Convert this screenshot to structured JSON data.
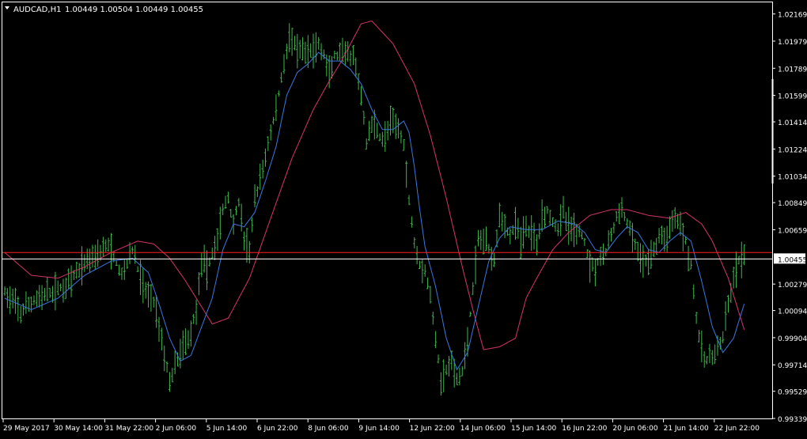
{
  "header": {
    "symbol": "AUDCAD,H1",
    "ohlc": "1.00449 1.00504 1.00449 1.00455"
  },
  "colors": {
    "background": "#000000",
    "frame": "#ffffff",
    "bars": "#3cb84a",
    "ma_fast": "#3a78e0",
    "bollinger": "#d8326c",
    "price_line": "#ffffff",
    "red_line": "#ff2020",
    "price_marker_bg": "#ffffff",
    "text": "#ffffff"
  },
  "chart_data": {
    "type": "ohlc",
    "xlabel": "",
    "ylabel": "",
    "ylim": [
      0.99339,
      1.0225
    ],
    "grid": false,
    "y_ticks": [
      "1.02169",
      "1.01979",
      "1.01789",
      "1.01599",
      "1.01414",
      "1.01224",
      "1.01034",
      "1.00849",
      "1.00659",
      "1.00455",
      "1.00279",
      "1.00094",
      "0.99904",
      "0.99714",
      "0.99529",
      "0.99339"
    ],
    "x_ticks": [
      "29 May 2017",
      "30 May 14:00",
      "31 May 22:00",
      "2 Jun 06:00",
      "5 Jun 14:00",
      "6 Jun 22:00",
      "8 Jun 06:00",
      "9 Jun 14:00",
      "12 Jun 22:00",
      "14 Jun 06:00",
      "15 Jun 14:00",
      "16 Jun 22:00",
      "20 Jun 06:00",
      "21 Jun 14:00",
      "22 Jun 22:00"
    ],
    "current_price": 1.00455,
    "horizontal_lines": [
      {
        "name": "red-level",
        "value": 1.005
      }
    ],
    "price_path": [
      [
        0,
        1.0022
      ],
      [
        6,
        1.0008
      ],
      [
        12,
        1.0018
      ],
      [
        18,
        1.0022
      ],
      [
        24,
        1.0028
      ],
      [
        30,
        1.0043
      ],
      [
        34,
        1.0049
      ],
      [
        39,
        1.0055
      ],
      [
        44,
        1.0034
      ],
      [
        48,
        1.0052
      ],
      [
        52,
        1.0026
      ],
      [
        56,
        1.0016
      ],
      [
        58,
        1.0
      ],
      [
        60,
        0.9978
      ],
      [
        62,
        0.996
      ],
      [
        64,
        0.997
      ],
      [
        66,
        0.998
      ],
      [
        70,
        0.9994
      ],
      [
        72,
        1.0012
      ],
      [
        74,
        1.0044
      ],
      [
        76,
        1.0038
      ],
      [
        80,
        1.006
      ],
      [
        82,
        1.008
      ],
      [
        84,
        1.0088
      ],
      [
        86,
        1.007
      ],
      [
        88,
        1.0086
      ],
      [
        90,
        1.0058
      ],
      [
        92,
        1.0052
      ],
      [
        94,
        1.0086
      ],
      [
        96,
        1.01
      ],
      [
        98,
        1.0118
      ],
      [
        100,
        1.0134
      ],
      [
        102,
        1.015
      ],
      [
        104,
        1.0172
      ],
      [
        107,
        1.0202
      ],
      [
        110,
        1.019
      ],
      [
        114,
        1.019
      ],
      [
        118,
        1.0195
      ],
      [
        120,
        1.0188
      ],
      [
        122,
        1.0174
      ],
      [
        124,
        1.0187
      ],
      [
        128,
        1.0188
      ],
      [
        131,
        1.0186
      ],
      [
        134,
        1.016
      ],
      [
        136,
        1.0126
      ],
      [
        138,
        1.0142
      ],
      [
        142,
        1.0128
      ],
      [
        145,
        1.014
      ],
      [
        148,
        1.0138
      ],
      [
        150,
        1.0126
      ],
      [
        152,
        1.0086
      ],
      [
        154,
        1.0058
      ],
      [
        156,
        1.0042
      ],
      [
        158,
        1.0038
      ],
      [
        160,
        1.0018
      ],
      [
        162,
        0.999
      ],
      [
        164,
        0.996
      ],
      [
        166,
        0.9968
      ],
      [
        168,
        0.9972
      ],
      [
        170,
        0.996
      ],
      [
        172,
        0.9966
      ],
      [
        174,
        0.999
      ],
      [
        176,
        1.0024
      ],
      [
        178,
        1.0058
      ],
      [
        180,
        1.006
      ],
      [
        184,
        1.0046
      ],
      [
        186,
        1.0078
      ],
      [
        188,
        1.0068
      ],
      [
        190,
        1.0062
      ],
      [
        192,
        1.007
      ],
      [
        194,
        1.0058
      ],
      [
        196,
        1.0068
      ],
      [
        200,
        1.0058
      ],
      [
        202,
        1.0076
      ],
      [
        204,
        1.008
      ],
      [
        206,
        1.0072
      ],
      [
        208,
        1.0068
      ],
      [
        210,
        1.0078
      ],
      [
        212,
        1.0068
      ],
      [
        216,
        1.0064
      ],
      [
        218,
        1.0058
      ],
      [
        220,
        1.0042
      ],
      [
        222,
        1.004
      ],
      [
        224,
        1.0048
      ],
      [
        226,
        1.005
      ],
      [
        228,
        1.0062
      ],
      [
        230,
        1.0074
      ],
      [
        232,
        1.008
      ],
      [
        234,
        1.007
      ],
      [
        236,
        1.006
      ],
      [
        238,
        1.005
      ],
      [
        240,
        1.0042
      ],
      [
        244,
        1.005
      ],
      [
        246,
        1.0062
      ],
      [
        248,
        1.0058
      ],
      [
        250,
        1.0068
      ],
      [
        252,
        1.0076
      ],
      [
        254,
        1.007
      ],
      [
        256,
        1.0058
      ],
      [
        258,
        1.0042
      ],
      [
        260,
        1.0004
      ],
      [
        262,
        0.998
      ],
      [
        264,
        0.9974
      ],
      [
        266,
        0.9978
      ],
      [
        268,
        0.9982
      ],
      [
        270,
        0.999
      ],
      [
        272,
        1.0012
      ],
      [
        274,
        1.0032
      ],
      [
        276,
        1.0044
      ],
      [
        278,
        1.0046
      ]
    ],
    "ma_fast": [
      [
        0,
        1.0018
      ],
      [
        10,
        1.001
      ],
      [
        20,
        1.0018
      ],
      [
        30,
        1.0034
      ],
      [
        40,
        1.0044
      ],
      [
        48,
        1.0046
      ],
      [
        54,
        1.0036
      ],
      [
        58,
        1.0014
      ],
      [
        62,
        0.999
      ],
      [
        66,
        0.9974
      ],
      [
        70,
        0.9978
      ],
      [
        74,
        0.9998
      ],
      [
        78,
        1.0018
      ],
      [
        82,
        1.0052
      ],
      [
        86,
        1.007
      ],
      [
        90,
        1.0068
      ],
      [
        94,
        1.0078
      ],
      [
        98,
        1.01
      ],
      [
        102,
        1.0124
      ],
      [
        106,
        1.016
      ],
      [
        110,
        1.0176
      ],
      [
        114,
        1.0182
      ],
      [
        118,
        1.019
      ],
      [
        122,
        1.0184
      ],
      [
        126,
        1.0184
      ],
      [
        130,
        1.0178
      ],
      [
        134,
        1.0168
      ],
      [
        138,
        1.015
      ],
      [
        142,
        1.0136
      ],
      [
        146,
        1.0136
      ],
      [
        150,
        1.0142
      ],
      [
        152,
        1.0134
      ],
      [
        154,
        1.011
      ],
      [
        156,
        1.008
      ],
      [
        158,
        1.0054
      ],
      [
        162,
        1.0026
      ],
      [
        166,
        0.999
      ],
      [
        170,
        0.9968
      ],
      [
        174,
        0.998
      ],
      [
        178,
        1.0012
      ],
      [
        182,
        1.0044
      ],
      [
        186,
        1.006
      ],
      [
        190,
        1.0068
      ],
      [
        196,
        1.0066
      ],
      [
        202,
        1.0066
      ],
      [
        208,
        1.0072
      ],
      [
        214,
        1.007
      ],
      [
        218,
        1.0064
      ],
      [
        222,
        1.0052
      ],
      [
        226,
        1.005
      ],
      [
        230,
        1.006
      ],
      [
        234,
        1.0068
      ],
      [
        238,
        1.0064
      ],
      [
        242,
        1.0052
      ],
      [
        246,
        1.005
      ],
      [
        250,
        1.0058
      ],
      [
        254,
        1.0064
      ],
      [
        258,
        1.0058
      ],
      [
        262,
        1.003
      ],
      [
        266,
        0.9998
      ],
      [
        270,
        0.998
      ],
      [
        274,
        0.999
      ],
      [
        278,
        1.0014
      ]
    ],
    "bollinger": [
      [
        0,
        1.005
      ],
      [
        10,
        1.0034
      ],
      [
        20,
        1.0032
      ],
      [
        30,
        1.004
      ],
      [
        40,
        1.005
      ],
      [
        50,
        1.0058
      ],
      [
        56,
        1.0056
      ],
      [
        62,
        1.0046
      ],
      [
        68,
        1.003
      ],
      [
        74,
        1.0012
      ],
      [
        78,
        1.0
      ],
      [
        84,
        1.0004
      ],
      [
        92,
        1.0032
      ],
      [
        100,
        1.0074
      ],
      [
        108,
        1.0116
      ],
      [
        116,
        1.015
      ],
      [
        122,
        1.017
      ],
      [
        126,
        1.0182
      ],
      [
        130,
        1.0196
      ],
      [
        134,
        1.021
      ],
      [
        138,
        1.0212
      ],
      [
        146,
        1.0196
      ],
      [
        154,
        1.0168
      ],
      [
        160,
        1.0132
      ],
      [
        166,
        1.0088
      ],
      [
        172,
        1.004
      ],
      [
        176,
        1.001
      ],
      [
        180,
        0.9982
      ],
      [
        186,
        0.9984
      ],
      [
        192,
        0.999
      ],
      [
        196,
        1.0018
      ],
      [
        200,
        1.0032
      ],
      [
        206,
        1.0052
      ],
      [
        212,
        1.0064
      ],
      [
        220,
        1.0076
      ],
      [
        228,
        1.008
      ],
      [
        234,
        1.008
      ],
      [
        242,
        1.0076
      ],
      [
        250,
        1.0074
      ],
      [
        256,
        1.0078
      ],
      [
        262,
        1.007
      ],
      [
        266,
        1.0058
      ],
      [
        272,
        1.0032
      ],
      [
        278,
        0.9996
      ]
    ]
  }
}
